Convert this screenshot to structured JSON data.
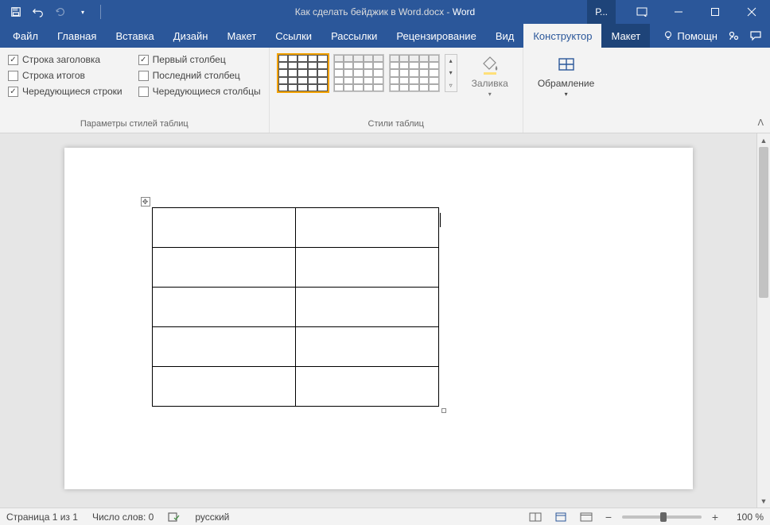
{
  "titlebar": {
    "doc_title": "Как сделать бейджик в Word.docx",
    "separator": " - ",
    "app_name": "Word",
    "user_short": "Р..."
  },
  "tabs": {
    "file": "Файл",
    "home": "Главная",
    "insert": "Вставка",
    "design": "Дизайн",
    "layout": "Макет",
    "references": "Ссылки",
    "mailings": "Рассылки",
    "review": "Рецензирование",
    "view": "Вид",
    "table_design": "Конструктор",
    "table_layout": "Макет",
    "help": "Помощн"
  },
  "ribbon": {
    "options_group": "Параметры стилей таблиц",
    "styles_group": "Стили таблиц",
    "chk_header_row": "Строка заголовка",
    "chk_total_row": "Строка итогов",
    "chk_banded_rows": "Чередующиеся строки",
    "chk_first_col": "Первый столбец",
    "chk_last_col": "Последний столбец",
    "chk_banded_cols": "Чередующиеся столбцы",
    "chk_state": {
      "header_row": true,
      "total_row": false,
      "banded_rows": true,
      "first_col": true,
      "last_col": false,
      "banded_cols": false
    },
    "shading": "Заливка",
    "borders": "Обрамление"
  },
  "document": {
    "table": {
      "rows": 5,
      "cols": 2
    }
  },
  "statusbar": {
    "page": "Страница 1 из 1",
    "words": "Число слов: 0",
    "language": "русский",
    "zoom": "100 %"
  }
}
